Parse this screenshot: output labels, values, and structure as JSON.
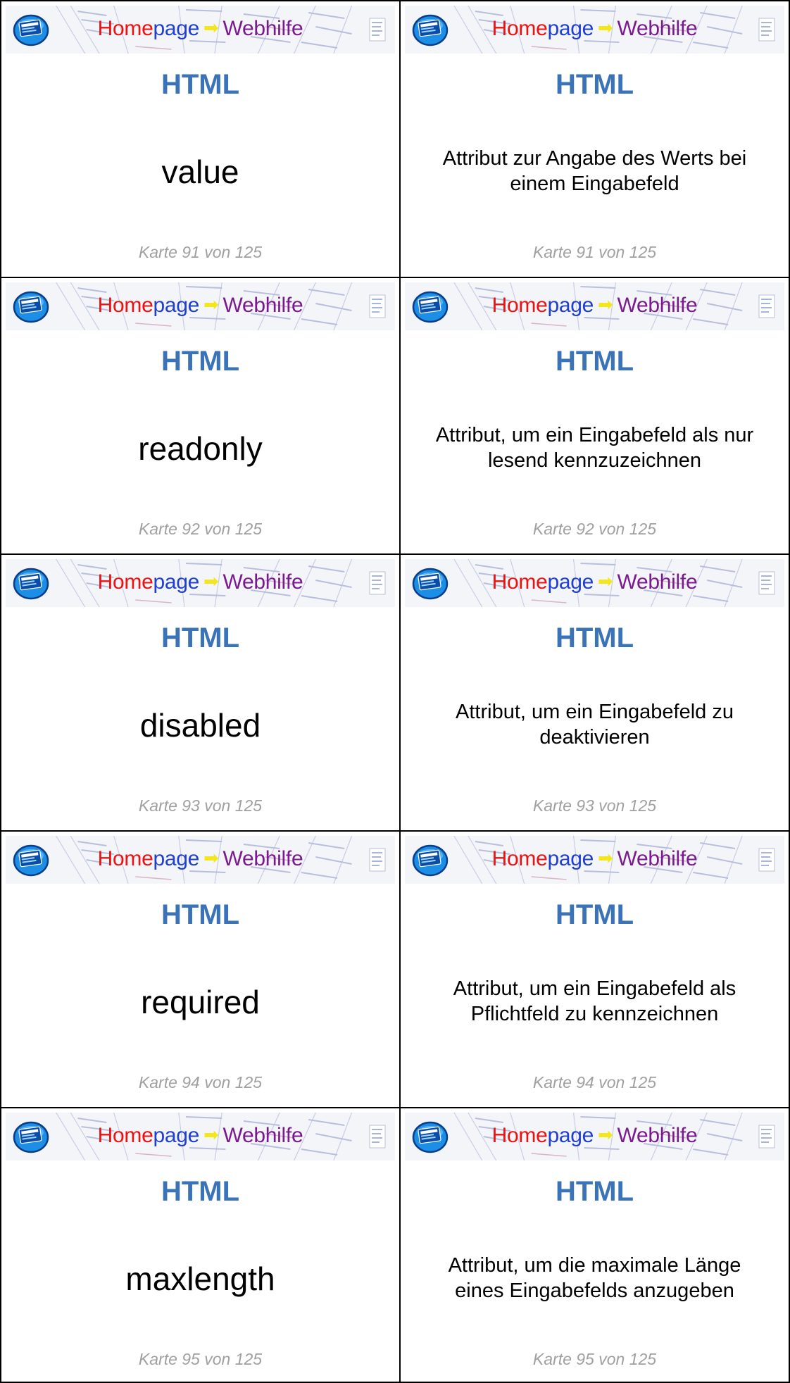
{
  "banner": {
    "part1": "Home",
    "part2": "page",
    "part3": "Webhilfe",
    "colors": {
      "home": "#ee1111",
      "page": "#1f3fd1",
      "arrow": "#f2e61c",
      "webhilfe": "#7a1a8f"
    }
  },
  "subject": "HTML",
  "colors": {
    "subject": "#3b73b9",
    "footer": "#a0a0a0",
    "border": "#000000"
  },
  "cards": [
    {
      "term": "value",
      "definition": "Attribut zur Angabe des Werts bei einem Eingabefeld",
      "label": "Karte 91 von 125"
    },
    {
      "term": "readonly",
      "definition": "Attribut, um ein Eingabefeld als nur lesend kennzuzeichnen",
      "label": "Karte 92 von 125"
    },
    {
      "term": "disabled",
      "definition": "Attribut, um ein Eingabefeld zu deaktivieren",
      "label": "Karte 93 von 125"
    },
    {
      "term": "required",
      "definition": "Attribut, um ein Eingabefeld als Pflichtfeld zu kennzeichnen",
      "label": "Karte 94 von 125"
    },
    {
      "term": "maxlength",
      "definition": "Attribut, um die maximale Länge eines Eingabefelds anzugeben",
      "label": "Karte 95 von 125"
    }
  ]
}
